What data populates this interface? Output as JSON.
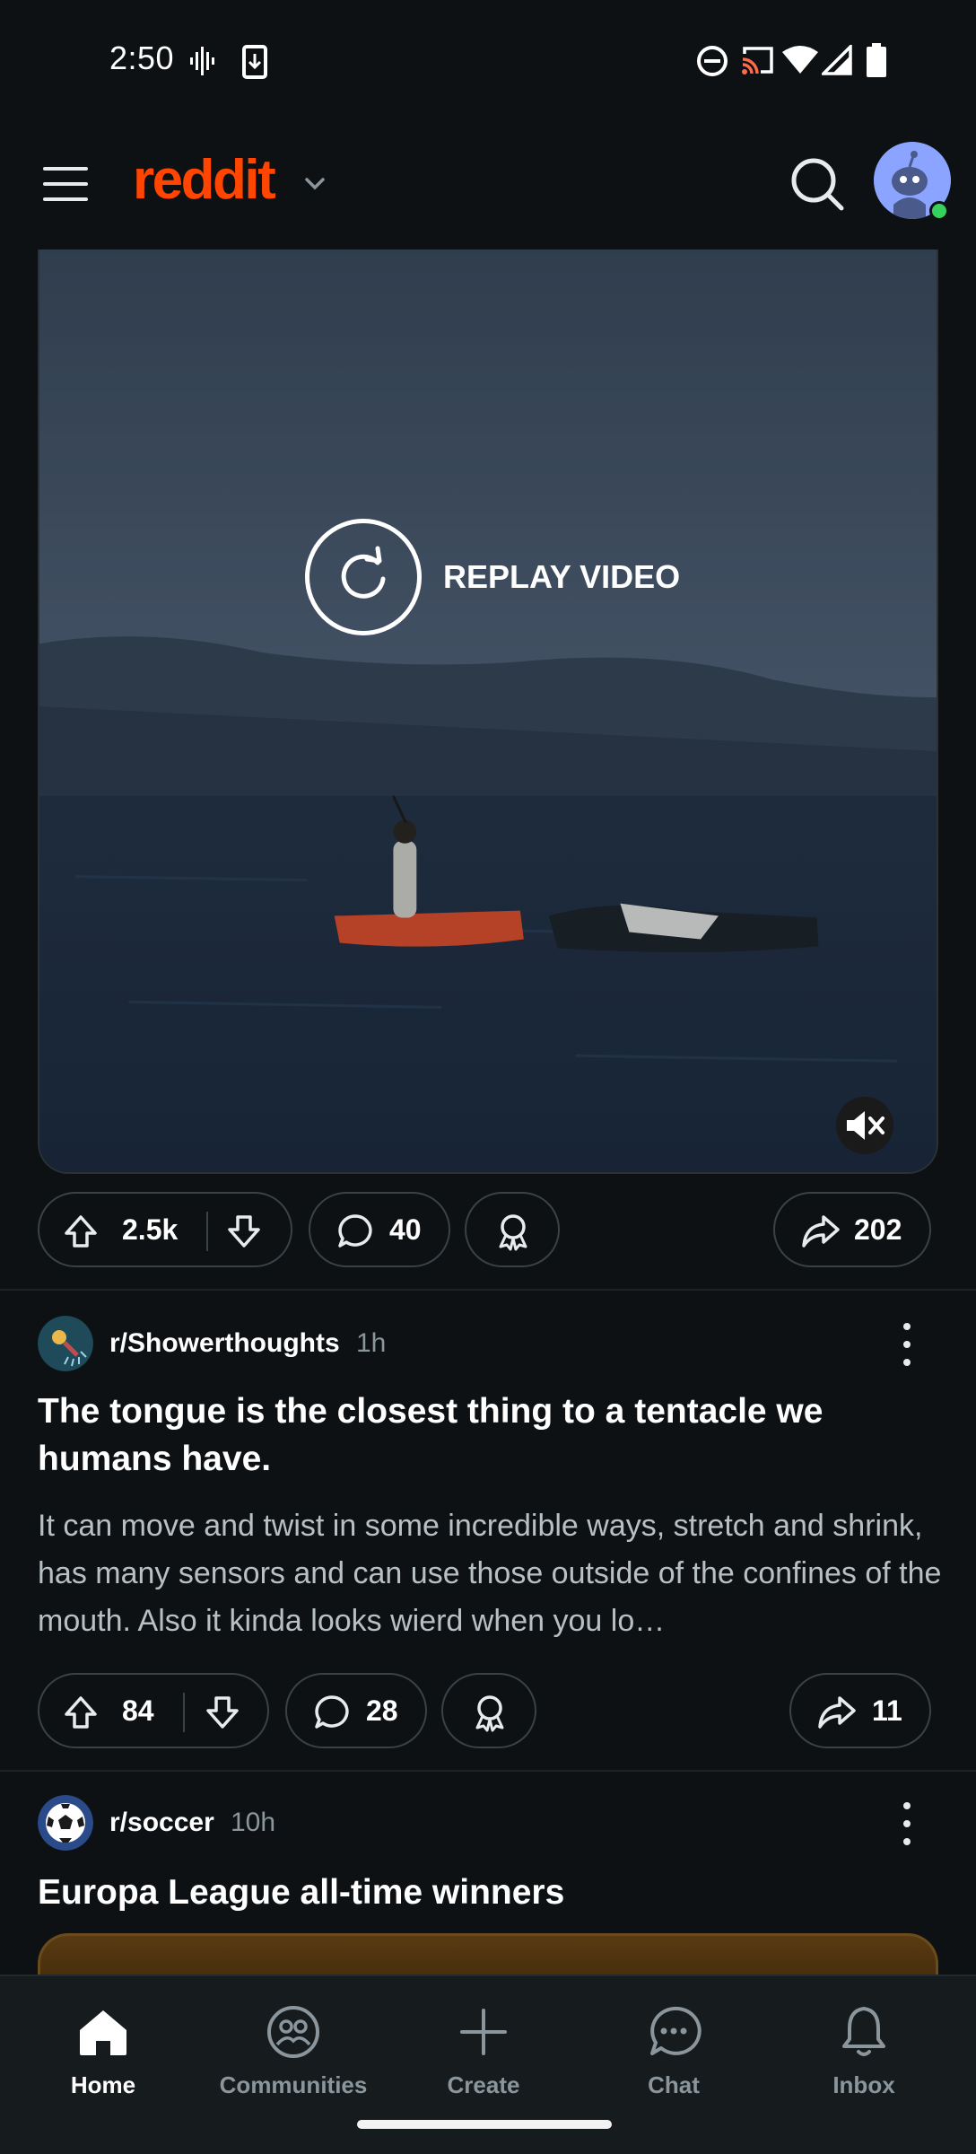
{
  "status_bar": {
    "time": "2:50",
    "icons": [
      "voicemail-icon",
      "download-icon",
      "do-not-disturb-icon",
      "cast-icon",
      "wifi-icon",
      "cellular-signal-icon",
      "battery-icon"
    ]
  },
  "header": {
    "logo_text": "reddit",
    "brand_color": "#ff4500",
    "icons": [
      "menu-icon",
      "chevron-down-icon",
      "search-icon",
      "avatar"
    ]
  },
  "video_post": {
    "replay_label": "REPLAY VIDEO",
    "upvotes": "2.5k",
    "comments": "40",
    "shares": "202"
  },
  "posts": [
    {
      "subreddit": "r/Showerthoughts",
      "time": "1h",
      "title": "The tongue is the closest thing to a tentacle we humans have.",
      "body": "It can move and twist in some incredible ways, stretch and shrink, has many sensors and can use those outside of the confines of the mouth. Also it kinda looks wierd when you lo…",
      "upvotes": "84",
      "comments": "28",
      "shares": "11"
    },
    {
      "subreddit": "r/soccer",
      "time": "10h",
      "title": "Europa League all-time winners"
    }
  ],
  "bottom_nav": {
    "items": [
      {
        "label": "Home",
        "icon": "home-icon",
        "active": true
      },
      {
        "label": "Communities",
        "icon": "communities-icon",
        "active": false
      },
      {
        "label": "Create",
        "icon": "plus-icon",
        "active": false
      },
      {
        "label": "Chat",
        "icon": "chat-icon",
        "active": false
      },
      {
        "label": "Inbox",
        "icon": "bell-icon",
        "active": false
      }
    ]
  }
}
